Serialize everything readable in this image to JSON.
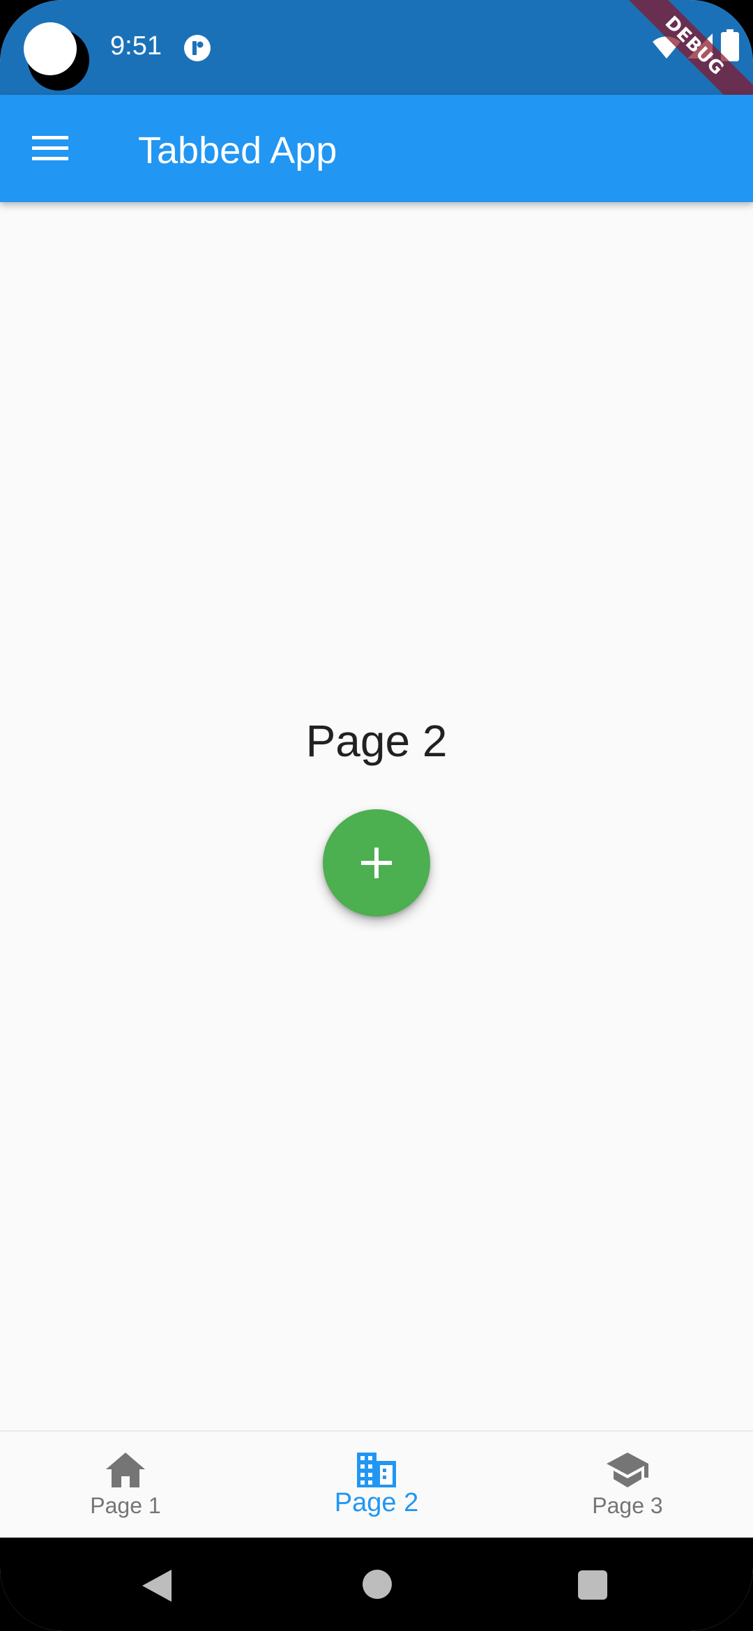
{
  "status_bar": {
    "time": "9:51",
    "background_color": "#1B71B8",
    "icons": [
      "notification-icon",
      "wifi-icon",
      "signal-icon",
      "battery-icon"
    ]
  },
  "debug_banner": {
    "label": "DEBUG",
    "color": "#881628"
  },
  "app_bar": {
    "title": "Tabbed App",
    "background_color": "#2196F3",
    "menu_icon": "menu-icon"
  },
  "main": {
    "heading": "Page 2",
    "fab": {
      "icon": "plus-icon",
      "color": "#4CAF50"
    }
  },
  "bottom_nav": {
    "active_index": 1,
    "active_color": "#2196F3",
    "inactive_color": "#757575",
    "items": [
      {
        "label": "Page 1",
        "icon": "home-icon"
      },
      {
        "label": "Page 2",
        "icon": "business-icon"
      },
      {
        "label": "Page 3",
        "icon": "school-icon"
      }
    ]
  },
  "system_nav": {
    "buttons": [
      "back-icon",
      "home-circle-icon",
      "recents-icon"
    ]
  }
}
